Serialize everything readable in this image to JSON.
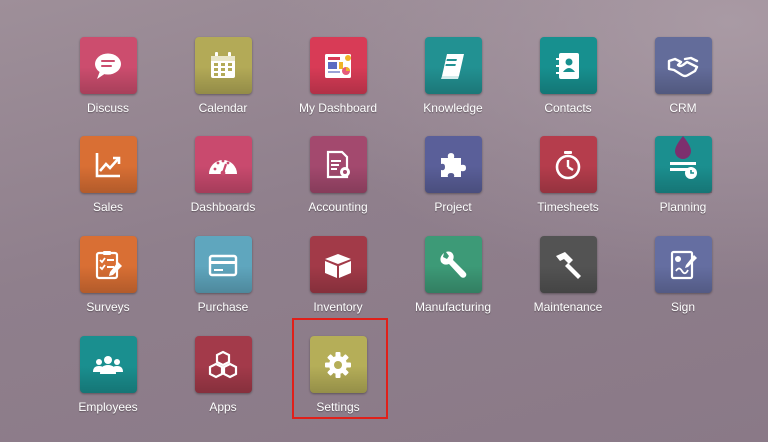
{
  "apps": [
    {
      "label": "Discuss",
      "color": "#cc4d6e",
      "icon": "chat-bubble-icon"
    },
    {
      "label": "Calendar",
      "color": "#b3aa57",
      "icon": "calendar-icon"
    },
    {
      "label": "My Dashboard",
      "color": "#d83b56",
      "icon": "dashboard-board-icon"
    },
    {
      "label": "Knowledge",
      "color": "#229192",
      "icon": "book-icon"
    },
    {
      "label": "Contacts",
      "color": "#17908f",
      "icon": "address-book-icon"
    },
    {
      "label": "CRM",
      "color": "#636c9a",
      "icon": "handshake-icon"
    },
    {
      "label": "Sales",
      "color": "#d96f34",
      "icon": "trend-chart-icon"
    },
    {
      "label": "Dashboards",
      "color": "#c94a6e",
      "icon": "speedometer-icon"
    },
    {
      "label": "Accounting",
      "color": "#a3496e",
      "icon": "invoice-gear-icon"
    },
    {
      "label": "Project",
      "color": "#5a5f99",
      "icon": "puzzle-icon"
    },
    {
      "label": "Timesheets",
      "color": "#b53d4c",
      "icon": "stopwatch-icon"
    },
    {
      "label": "Planning",
      "color": "#1b8f8f",
      "icon": "planning-icon"
    },
    {
      "label": "Surveys",
      "color": "#d96f34",
      "icon": "checklist-icon"
    },
    {
      "label": "Purchase",
      "color": "#5fa6be",
      "icon": "credit-card-icon"
    },
    {
      "label": "Inventory",
      "color": "#a23a48",
      "icon": "box-icon"
    },
    {
      "label": "Manufacturing",
      "color": "#3d9a77",
      "icon": "wrench-icon"
    },
    {
      "label": "Maintenance",
      "color": "#535353",
      "icon": "hammer-icon"
    },
    {
      "label": "Sign",
      "color": "#656ea1",
      "icon": "signature-icon"
    },
    {
      "label": "Employees",
      "color": "#1a8f8f",
      "icon": "people-group-icon"
    },
    {
      "label": "Apps",
      "color": "#a33a4a",
      "icon": "cubes-icon"
    },
    {
      "label": "Settings",
      "color": "#b5ae58",
      "icon": "gear-icon"
    }
  ],
  "highlighted_app": "Settings",
  "highlight_color": "#e0201a"
}
